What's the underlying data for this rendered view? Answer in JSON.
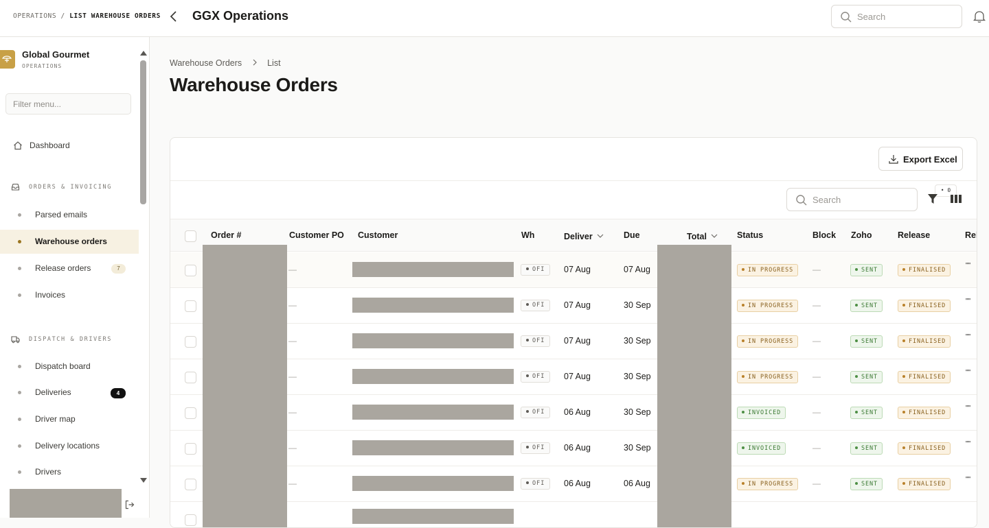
{
  "topbar": {
    "breadcrumb_root": "OPERATIONS",
    "breadcrumb_sep": "/",
    "breadcrumb_current": "LIST WAREHOUSE ORDERS",
    "app_title": "GGX Operations",
    "search_placeholder": "Search"
  },
  "sidebar": {
    "org_name": "Global Gourmet",
    "org_sub": "OPERATIONS",
    "filter_placeholder": "Filter menu...",
    "dashboard": "Dashboard",
    "sections": [
      {
        "title": "ORDERS & INVOICING",
        "items": [
          {
            "label": "Parsed emails",
            "active": false
          },
          {
            "label": "Warehouse orders",
            "active": true
          },
          {
            "label": "Release orders",
            "badge": "7"
          },
          {
            "label": "Invoices"
          }
        ]
      },
      {
        "title": "DISPATCH & DRIVERS",
        "items": [
          {
            "label": "Dispatch board"
          },
          {
            "label": "Deliveries",
            "badge": "4"
          },
          {
            "label": "Driver map"
          },
          {
            "label": "Delivery locations"
          },
          {
            "label": "Drivers"
          }
        ]
      }
    ]
  },
  "main": {
    "breadcrumb": [
      "Warehouse Orders",
      "List"
    ],
    "title": "Warehouse Orders",
    "export_label": "Export Excel",
    "table_search_placeholder": "Search",
    "filter_count": "0",
    "columns": [
      "Order #",
      "Customer PO",
      "Customer",
      "Wh",
      "Deliver",
      "Due",
      "Total",
      "Status",
      "Block",
      "Zoho",
      "Release",
      "Rel"
    ],
    "rows": [
      {
        "po": "—",
        "wh": "OFI",
        "deliver": "07 Aug",
        "due": "07 Aug",
        "status": "IN PROGRESS",
        "block": "—",
        "zoho": "SENT",
        "release": "FINALISED",
        "rel": "\"\""
      },
      {
        "po": "—",
        "wh": "OFI",
        "deliver": "07 Aug",
        "due": "30 Sep",
        "status": "IN PROGRESS",
        "block": "—",
        "zoho": "SENT",
        "release": "FINALISED",
        "rel": "\"\""
      },
      {
        "po": "—",
        "wh": "OFI",
        "deliver": "07 Aug",
        "due": "30 Sep",
        "status": "IN PROGRESS",
        "block": "—",
        "zoho": "SENT",
        "release": "FINALISED",
        "rel": "\"\""
      },
      {
        "po": "—",
        "wh": "OFI",
        "deliver": "07 Aug",
        "due": "30 Sep",
        "status": "IN PROGRESS",
        "block": "—",
        "zoho": "SENT",
        "release": "FINALISED",
        "rel": "\"\""
      },
      {
        "po": "—",
        "wh": "OFI",
        "deliver": "06 Aug",
        "due": "30 Sep",
        "status": "INVOICED",
        "block": "—",
        "zoho": "SENT",
        "release": "FINALISED",
        "rel": "\"\""
      },
      {
        "po": "—",
        "wh": "OFI",
        "deliver": "06 Aug",
        "due": "30 Sep",
        "status": "INVOICED",
        "block": "—",
        "zoho": "SENT",
        "release": "FINALISED",
        "rel": "\"\""
      },
      {
        "po": "—",
        "wh": "OFI",
        "deliver": "06 Aug",
        "due": "06 Aug",
        "status": "IN PROGRESS",
        "block": "—",
        "zoho": "SENT",
        "release": "FINALISED",
        "rel": "\"\""
      }
    ]
  },
  "colors": {
    "accent": "#c8a046",
    "progress": "#b9812a",
    "success": "#4d8f44",
    "redacted": "#aaa69f"
  }
}
